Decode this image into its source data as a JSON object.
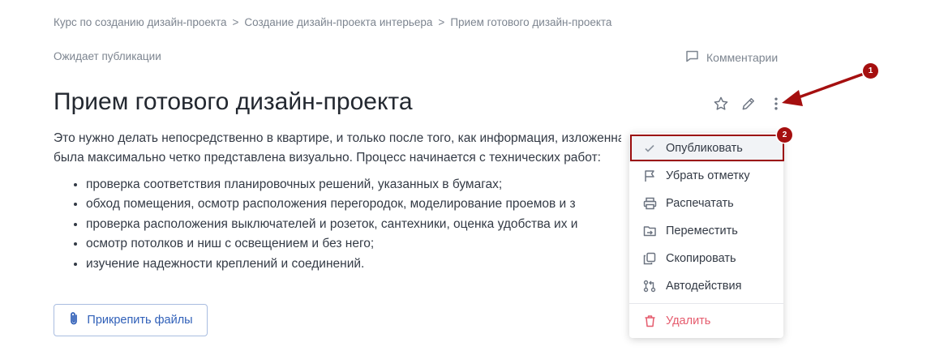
{
  "breadcrumb": {
    "items": [
      "Курс по созданию дизайн-проекта",
      "Создание дизайн-проекта интерьера",
      "Прием готового дизайн-проекта"
    ],
    "separator": ">"
  },
  "status": "Ожидает публикации",
  "comments_label": "Комментарии",
  "title": "Прием готового дизайн-проекта",
  "content": {
    "paragraph_lines": [
      "Это нужно делать непосредственно в квартире, и только после того, как информация, изложенная в документах,",
      "была максимально четко представлена визуально. Процесс начинается с технических работ:"
    ],
    "bullets": [
      "проверка соответствия планировочных решений, указанных в бумагах;",
      "обход помещения, осмотр расположения перегородок, моделирование проемов и з",
      "проверка расположения выключателей и розеток, сантехники, оценка удобства их и",
      "осмотр потолков и ниш с освещением и без него;",
      "изучение надежности креплений и соединений."
    ]
  },
  "attach_label": "Прикрепить файлы",
  "menu": {
    "items": [
      {
        "label": "Опубликовать",
        "icon": "check-icon"
      },
      {
        "label": "Убрать отметку",
        "icon": "flag-icon"
      },
      {
        "label": "Распечатать",
        "icon": "printer-icon"
      },
      {
        "label": "Переместить",
        "icon": "move-folder-icon"
      },
      {
        "label": "Скопировать",
        "icon": "copy-icon"
      },
      {
        "label": "Автодействия",
        "icon": "automation-icon"
      }
    ],
    "delete_label": "Удалить",
    "delete_icon": "trash-icon"
  },
  "annotations": {
    "badge1": "1",
    "badge2": "2",
    "color": "#a50f0f"
  },
  "colors": {
    "accent": "#2f5fb8",
    "danger": "#e55b6d",
    "muted": "#7d8590",
    "text": "#333a45"
  }
}
